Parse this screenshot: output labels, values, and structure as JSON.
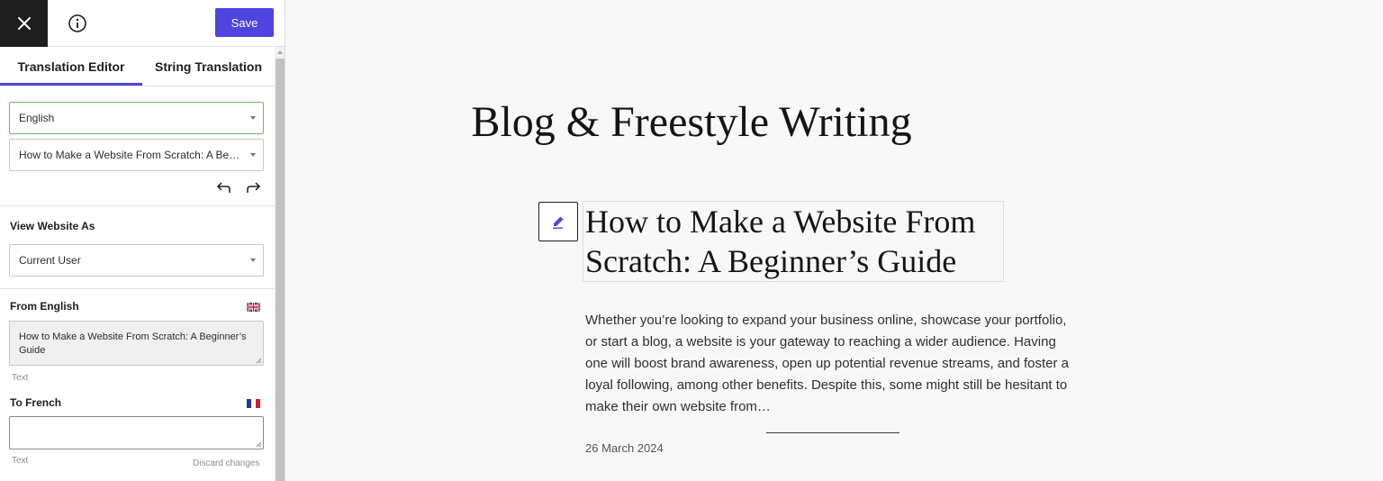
{
  "toolbar": {
    "save_label": "Save"
  },
  "tabs": [
    {
      "label": "Translation Editor",
      "active": true
    },
    {
      "label": "String Translation",
      "active": false
    }
  ],
  "editor": {
    "language_select": {
      "value": "English"
    },
    "page_select": {
      "value": "How to Make a Website From Scratch: A Beginner's Guide"
    },
    "view_as": {
      "title": "View Website As",
      "value": "Current User"
    },
    "from": {
      "title": "From English",
      "flag": "uk-flag",
      "text": "How to Make a Website From Scratch: A Beginner’s Guide",
      "type_label": "Text"
    },
    "to": {
      "title": "To French",
      "flag": "france-flag",
      "text": "",
      "type_label": "Text",
      "discard_label": "Discard changes"
    }
  },
  "preview": {
    "site_title": "Blog & Freestyle Writing",
    "post_title": "How to Make a Website From Scratch: A Beginner’s Guide",
    "excerpt": "Whether you’re looking to expand your business online, showcase your portfolio, or start a blog, a website is your gateway to reaching a wider audience. Having one will boost brand awareness, open up potential revenue streams, and foster a loyal following, among other benefits. Despite this, some might still be hesitant to make their own website from…",
    "date": "26 March 2024"
  },
  "colors": {
    "accent": "#4f44e0",
    "close_bg": "#1e1e1e",
    "active_select_border": "#6abf69"
  }
}
